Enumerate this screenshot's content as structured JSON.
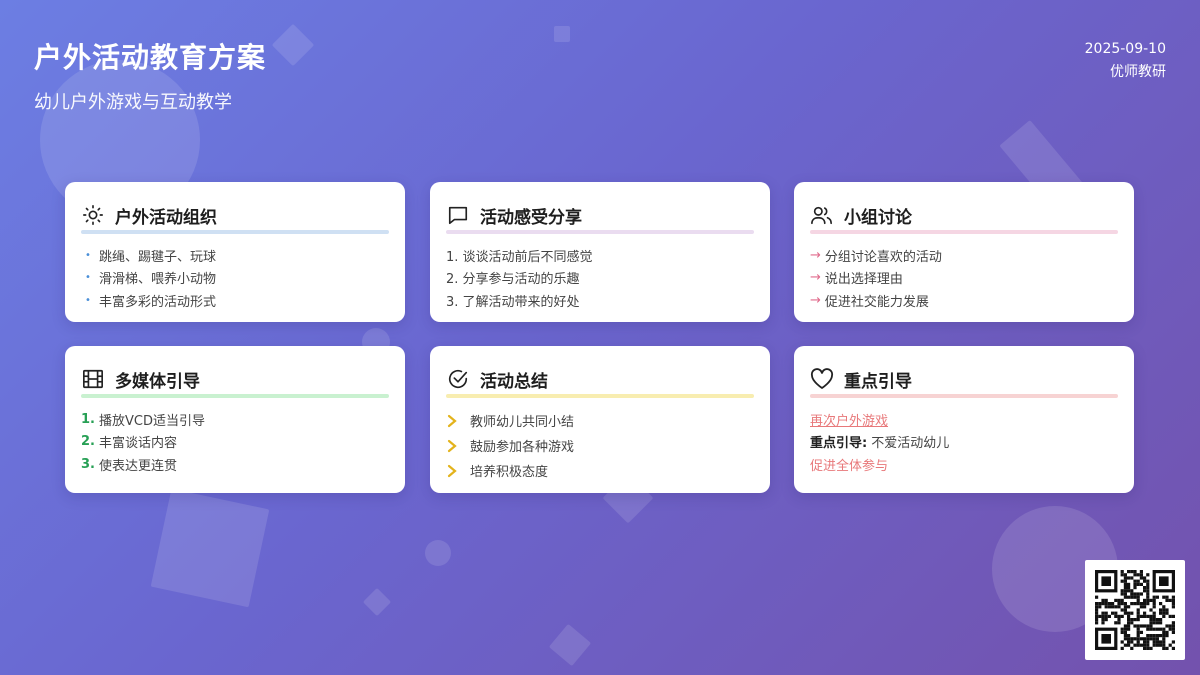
{
  "header": {
    "title": "户外活动教育方案",
    "subtitle": "幼儿户外游戏与互动教学",
    "date": "2025-09-10",
    "author": "优师教研"
  },
  "colors": {
    "blue_line": "#cfe0f3",
    "purple_line": "#eadcf0",
    "pink_line": "#f5d6e3",
    "green_line": "#c9f1d0",
    "yellow_line": "#f8edb0",
    "red_line": "#f7d3d3",
    "chevron": "#e3b31c"
  },
  "cards": {
    "outdoor": {
      "title": "户外活动组织",
      "icon": "sun-icon",
      "items": [
        "跳绳、踢毽子、玩球",
        "滑滑梯、喂养小动物",
        "丰富多彩的活动形式"
      ]
    },
    "share": {
      "title": "活动感受分享",
      "icon": "chat-icon",
      "items": [
        "1. 谈谈活动前后不同感觉",
        "2. 分享参与活动的乐趣",
        "3. 了解活动带来的好处"
      ]
    },
    "group": {
      "title": "小组讨论",
      "icon": "users-icon",
      "items": [
        "分组讨论喜欢的活动",
        "说出选择理由",
        "促进社交能力发展"
      ]
    },
    "media": {
      "title": "多媒体引导",
      "icon": "film-icon",
      "items": [
        {
          "num": "1.",
          "text": "播放VCD适当引导"
        },
        {
          "num": "2.",
          "text": "丰富谈话内容"
        },
        {
          "num": "3.",
          "text": "使表达更连贯"
        }
      ]
    },
    "summary": {
      "title": "活动总结",
      "icon": "check-circle-icon",
      "items": [
        "教师幼儿共同小结",
        "鼓励参加各种游戏",
        "培养积极态度"
      ]
    },
    "focus": {
      "title": "重点引导",
      "icon": "heart-icon",
      "link": "再次户外游戏",
      "label": "重点引导:",
      "value": "不爱活动幼儿",
      "last": "促进全体参与"
    }
  }
}
